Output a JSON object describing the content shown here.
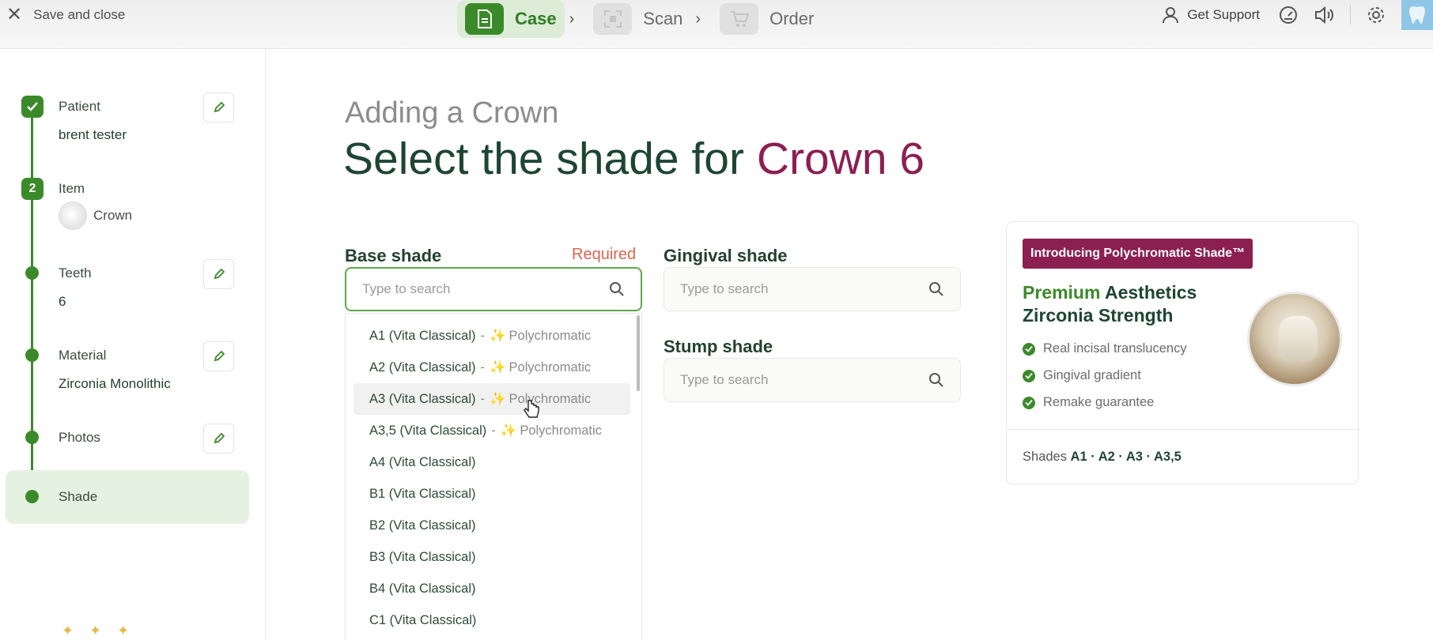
{
  "header": {
    "close_label": "Save and close",
    "steps": [
      {
        "label": "Case",
        "active": true
      },
      {
        "label": "Scan",
        "active": false
      },
      {
        "label": "Order",
        "active": false
      }
    ],
    "support_label": "Get Support"
  },
  "sidebar": {
    "items": [
      {
        "title": "Patient",
        "value": "brent tester",
        "marker": "check"
      },
      {
        "title": "Item",
        "value": "Crown",
        "marker": "2"
      },
      {
        "title": "Teeth",
        "value": "6"
      },
      {
        "title": "Material",
        "value": "Zirconia Monolithic"
      },
      {
        "title": "Photos",
        "value": ""
      },
      {
        "title": "Shade",
        "value": ""
      }
    ]
  },
  "main": {
    "subtitle": "Adding a Crown",
    "title_prefix": "Select the shade for ",
    "title_accent": "Crown 6",
    "base_shade": {
      "label": "Base shade",
      "required": "Required",
      "placeholder": "Type to search",
      "options": [
        {
          "name": "A1 (Vita Classical)",
          "poly": "Polychromatic"
        },
        {
          "name": "A2 (Vita Classical)",
          "poly": "Polychromatic"
        },
        {
          "name": "A3 (Vita Classical)",
          "poly": "Polychromatic"
        },
        {
          "name": "A3,5 (Vita Classical)",
          "poly": "Polychromatic"
        },
        {
          "name": "A4 (Vita Classical)",
          "poly": ""
        },
        {
          "name": "B1 (Vita Classical)",
          "poly": ""
        },
        {
          "name": "B2 (Vita Classical)",
          "poly": ""
        },
        {
          "name": "B3 (Vita Classical)",
          "poly": ""
        },
        {
          "name": "B4 (Vita Classical)",
          "poly": ""
        },
        {
          "name": "C1 (Vita Classical)",
          "poly": ""
        }
      ],
      "hovered_index": 2
    },
    "gingival_shade": {
      "label": "Gingival shade",
      "placeholder": "Type to search"
    },
    "stump_shade": {
      "label": "Stump shade",
      "placeholder": "Type to search"
    }
  },
  "promo": {
    "badge": "Introducing Polychromatic Shade™",
    "heading_green": "Premium",
    "heading_rest1": " Aesthetics",
    "heading_line2": "Zirconia Strength",
    "features": [
      "Real incisal translucency",
      "Gingival gradient",
      "Remake guarantee"
    ],
    "footer_prefix": "Shades ",
    "footer_shades": "A1 · A2 · A3 · A3,5"
  },
  "colors": {
    "brand_green": "#3b8a2a",
    "accent_plum": "#8b1f52",
    "required_red": "#e0654f"
  }
}
